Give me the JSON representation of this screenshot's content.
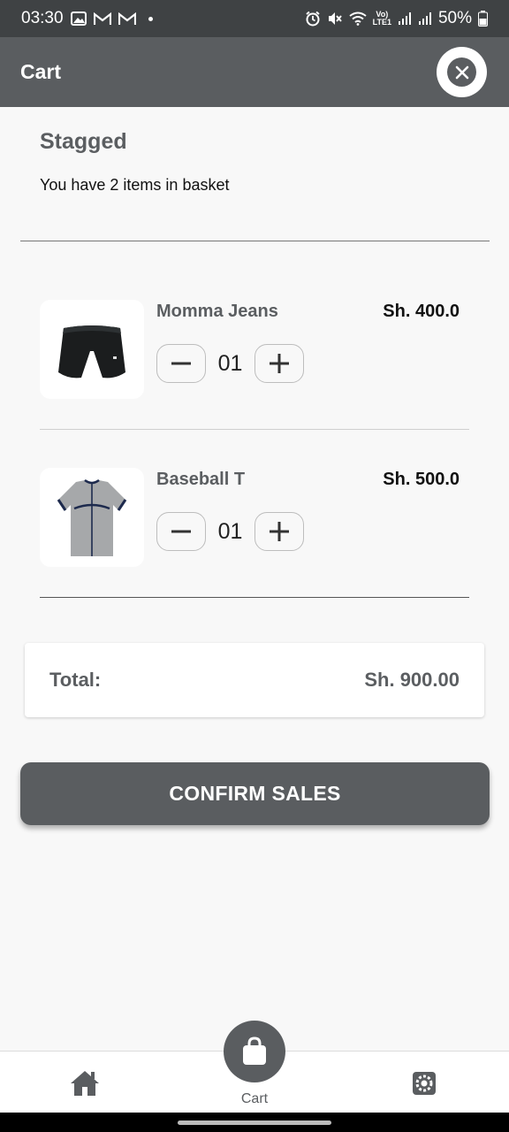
{
  "status_bar": {
    "time": "03:30",
    "battery": "50%",
    "network_label": "LTE1"
  },
  "app_bar": {
    "title": "Cart",
    "close_icon": "close-icon"
  },
  "basket": {
    "title": "Stagged",
    "subtitle": "You have 2 items in basket"
  },
  "items": [
    {
      "name": "Momma Jeans",
      "price": "Sh. 400.0",
      "quantity": "01",
      "image": "black-shorts"
    },
    {
      "name": "Baseball T",
      "price": "Sh. 500.0",
      "quantity": "01",
      "image": "baseball-jersey"
    }
  ],
  "total": {
    "label": "Total:",
    "value": "Sh. 900.00"
  },
  "actions": {
    "confirm_label": "CONFIRM SALES"
  },
  "bottom_nav": {
    "cart_label": "Cart",
    "icons": [
      "home-icon",
      "shopping-bag-icon",
      "gear-icon"
    ]
  },
  "colors": {
    "primary": "#5a5d60",
    "status_bar": "#3f4244",
    "background": "#f8f8f8"
  }
}
